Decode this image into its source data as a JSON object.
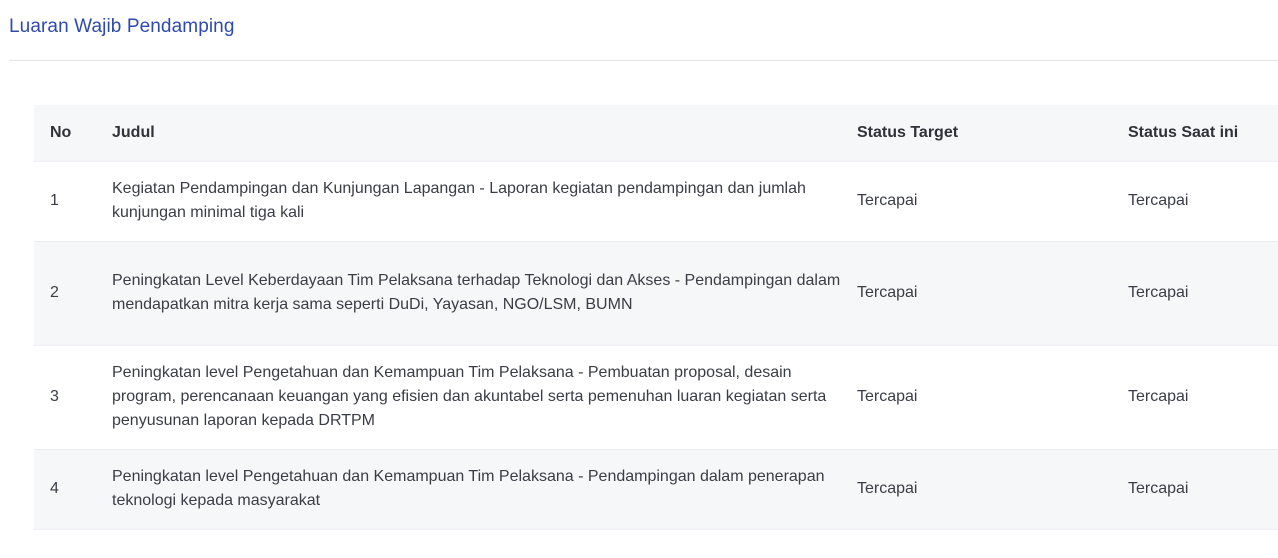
{
  "page": {
    "title": "Luaran Wajib Pendamping"
  },
  "table": {
    "headers": {
      "no": "No",
      "judul": "Judul",
      "status_target": "Status Target",
      "status_saat_ini": "Status Saat ini"
    },
    "rows": [
      {
        "no": "1",
        "judul": "Kegiatan Pendampingan dan Kunjungan Lapangan - Laporan kegiatan pendampingan dan jumlah kunjungan minimal tiga kali",
        "status_target": "Tercapai",
        "status_saat_ini": "Tercapai"
      },
      {
        "no": "2",
        "judul": "Peningkatan Level Keberdayaan Tim Pelaksana terhadap Teknologi dan Akses - Pendampingan dalam mendapatkan mitra kerja sama seperti DuDi, Yayasan, NGO/LSM, BUMN",
        "status_target": "Tercapai",
        "status_saat_ini": "Tercapai"
      },
      {
        "no": "3",
        "judul": "Peningkatan level Pengetahuan dan Kemampuan Tim Pelaksana - Pembuatan proposal, desain program, perencanaan keuangan yang efisien dan akuntabel serta pemenuhan luaran kegiatan serta penyusunan laporan kepada DRTPM",
        "status_target": "Tercapai",
        "status_saat_ini": "Tercapai"
      },
      {
        "no": "4",
        "judul": "Peningkatan level Pengetahuan dan Kemampuan Tim Pelaksana - Pendampingan dalam penerapan teknologi kepada masyarakat",
        "status_target": "Tercapai",
        "status_saat_ini": "Tercapai"
      }
    ]
  },
  "colors": {
    "title": "#2e4bac",
    "header_bg": "#f6f7f8",
    "row_alt_bg": "#f6f7f8",
    "divider": "#e2e4e8"
  }
}
